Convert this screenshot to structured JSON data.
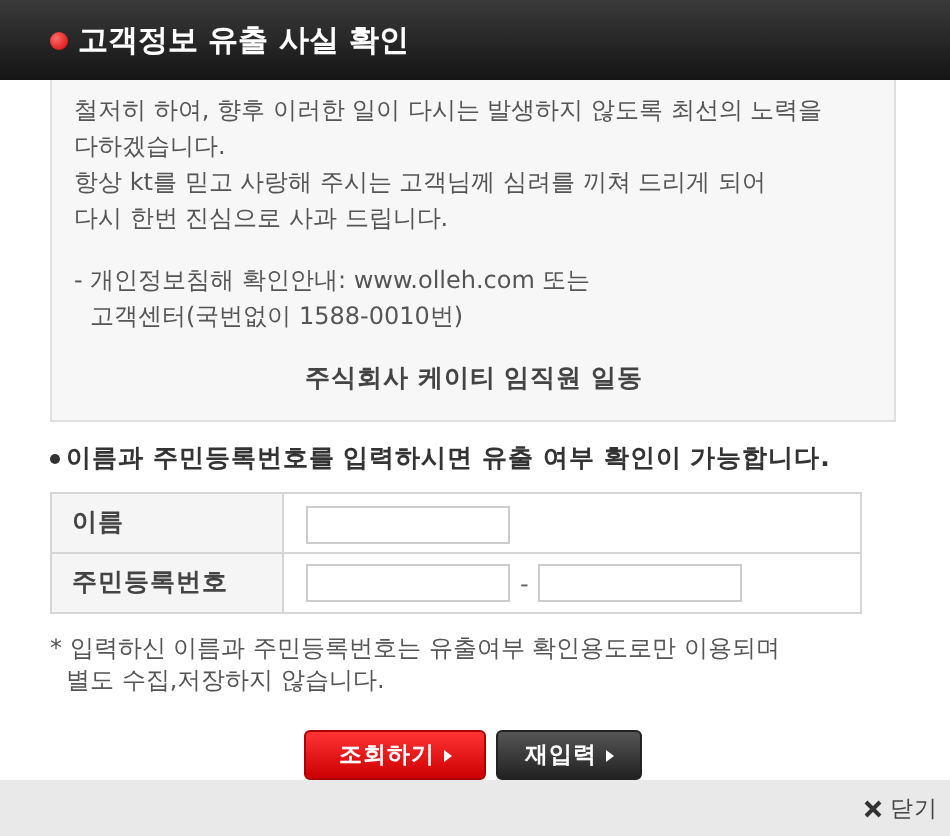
{
  "header": {
    "title": "고객정보 유출 사실 확인"
  },
  "notice": {
    "paragraphs": [
      [
        "철저히 하여, 향후 이러한 일이 다시는 발생하지 않도록 최선의 노력을",
        "다하겠습니다.",
        "항상 kt를 믿고 사랑해 주시는 고객님께 심려를 끼쳐 드리게 되어",
        "다시 한번 진심으로 사과 드립니다."
      ],
      [
        "- 개인정보침해 확인안내: www.olleh.com 또는",
        "고객센터(국번없이 1588-0010번)"
      ]
    ],
    "signature": "주식회사 케이티 임직원 일동"
  },
  "form": {
    "heading": "이름과 주민등록번호를 입력하시면 유출 여부 확인이 가능합니다.",
    "fields": [
      {
        "label": "이름",
        "kind": "single"
      },
      {
        "label": "주민등록번호",
        "kind": "split",
        "separator": "-"
      }
    ]
  },
  "disclaimer": [
    "* 입력하신 이름과 주민등록번호는 유출여부 확인용도로만 이용되며",
    "별도 수집,저장하지 않습니다."
  ],
  "buttons": [
    {
      "label": "조회하기",
      "kind": "primary"
    },
    {
      "label": "재입력",
      "kind": "secondary"
    }
  ],
  "footer": {
    "close": "닫기"
  }
}
